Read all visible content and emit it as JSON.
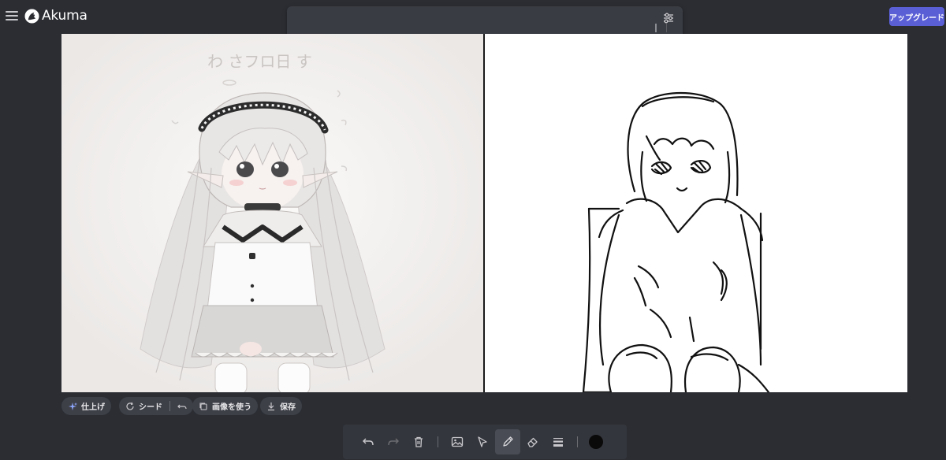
{
  "app": {
    "name": "Akuma",
    "upgrade_label": "アップグレード"
  },
  "prompt": {
    "value": "",
    "placeholder": ""
  },
  "actions": {
    "finish_label": "仕上げ",
    "seed_label": "シード",
    "use_image_label": "画像を使う",
    "save_label": "保存"
  },
  "generated_image": {
    "handwritten_text": "わ さフロ日 す"
  },
  "toolbar": {
    "tools": [
      "undo-icon",
      "redo-icon",
      "trash-icon",
      "image-icon",
      "select-icon",
      "pencil-icon",
      "eraser-icon",
      "stroke-width-icon"
    ],
    "active_tool": "pencil",
    "brush_color": "#0a0a0a"
  },
  "colors": {
    "background": "#2b2d33",
    "accent": "#5b5fd6",
    "pill": "#3e4048"
  }
}
